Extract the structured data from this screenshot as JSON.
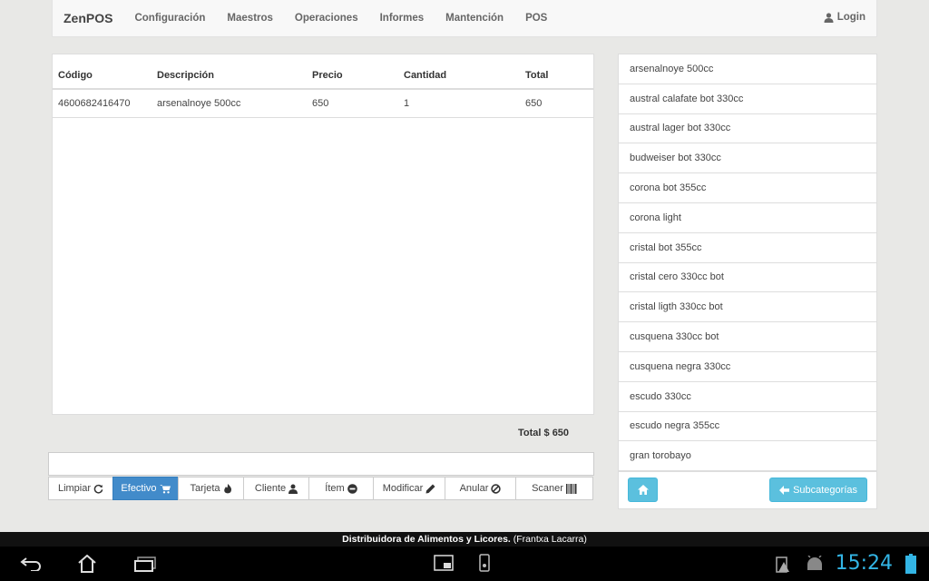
{
  "nav": {
    "brand": "ZenPOS",
    "items": [
      "Configuración",
      "Maestros",
      "Operaciones",
      "Informes",
      "Mantención",
      "POS"
    ],
    "login": "Login"
  },
  "sale": {
    "columns": [
      "Código",
      "Descripción",
      "Precio",
      "Cantidad",
      "Total"
    ],
    "rows": [
      [
        "4600682416470",
        "arsenalnoye 500cc",
        "650",
        "1",
        "650"
      ]
    ],
    "total_label": "Total $ 650"
  },
  "actions": [
    "Limpiar",
    "Efectivo",
    "Tarjeta",
    "Cliente",
    "Ítem",
    "Modificar",
    "Anular",
    "Scaner"
  ],
  "products": [
    "arsenalnoye 500cc",
    "austral calafate bot 330cc",
    "austral lager bot 330cc",
    "budweiser bot 330cc",
    "corona bot 355cc",
    "corona light",
    "cristal bot 355cc",
    "cristal cero 330cc bot",
    "cristal ligth 330cc bot",
    "cusquena 330cc bot",
    "cusquena negra 330cc",
    "escudo 330cc",
    "escudo negra 355cc",
    "gran torobayo"
  ],
  "list_footer": {
    "subcategories": "Subcategorías"
  },
  "company": {
    "name": "Distribuidora de Alimentos y Licores.",
    "user": " (Frantxa Lacarra)"
  },
  "system": {
    "clock": "15:24"
  },
  "colors": {
    "primary": "#428bca",
    "info": "#5bc0de",
    "clock": "#33b5e5"
  }
}
